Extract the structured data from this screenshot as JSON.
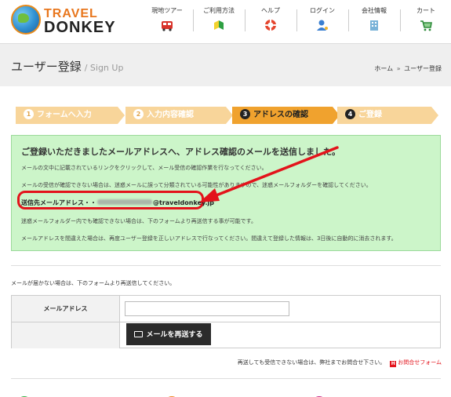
{
  "logo": {
    "line1": "TRAVEL",
    "line2": "DONKEY"
  },
  "nav": {
    "items": [
      {
        "label": "現地ツアー",
        "icon": "bus-icon"
      },
      {
        "label": "ご利用方法",
        "icon": "beginner-mark-icon"
      },
      {
        "label": "ヘルプ",
        "icon": "lifebuoy-icon"
      },
      {
        "label": "ログイン",
        "icon": "user-key-icon"
      },
      {
        "label": "会社情報",
        "icon": "building-icon"
      },
      {
        "label": "カート",
        "icon": "cart-icon"
      }
    ]
  },
  "page": {
    "title": "ユーザー登録",
    "subtitle": "/ Sign Up"
  },
  "breadcrumb": {
    "home": "ホーム",
    "sep": "»",
    "current": "ユーザー登録"
  },
  "steps": [
    {
      "num": "1",
      "label": "フォームへ入力",
      "state": "past"
    },
    {
      "num": "2",
      "label": "入力内容確認",
      "state": "past"
    },
    {
      "num": "3",
      "label": "アドレスの確認",
      "state": "current"
    },
    {
      "num": "4",
      "label": "ご登録",
      "state": "next"
    }
  ],
  "notice": {
    "heading": "ご登録いただきましたメールアドレスへ、アドレス確認のメールを送信しました。",
    "p1": "メールの文中に記載されているリンクをクリックして、メール受信の確認作業を行なってください。",
    "p2": "メールの受信が確認できない場合は、迷惑メールに誤って分類されている可能性がありますので、迷惑メールフォルダーを確認してください。",
    "address_label": "送信先メールアドレス・・",
    "address_domain": "@traveldonkey.jp",
    "p3": "迷惑メールフォルダー内でも確認できない場合は、下のフォームより再送信する事が可能です。",
    "p4": "メールアドレスを間違えた場合は、再度ユーザー登録を正しいアドレスで行なってください。間違えて登録した情報は、3日後に自動的に消去されます。"
  },
  "form": {
    "note": "メールが届かない場合は、下のフォームより再送信してください。",
    "email_label": "メールアドレス",
    "email_value": "",
    "email_placeholder": "",
    "resend_label": "メールを再送する"
  },
  "bottom_note": {
    "text": "再送しても受信できない場合は、弊社までお問合せ下さい。",
    "link": "お問合せフォーム"
  },
  "colors": {
    "accent": "#f0a22e",
    "notice_bg": "#ccf5c9",
    "highlight": "#e3131b",
    "button": "#2b2b2b"
  }
}
